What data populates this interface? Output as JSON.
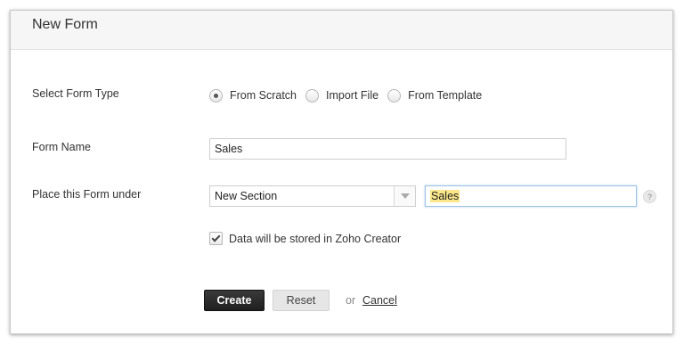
{
  "dialog": {
    "title": "New Form"
  },
  "form_type": {
    "label": "Select Form Type",
    "options": [
      {
        "label": "From Scratch",
        "selected": true
      },
      {
        "label": "Import File",
        "selected": false
      },
      {
        "label": "From Template",
        "selected": false
      }
    ]
  },
  "form_name": {
    "label": "Form Name",
    "value": "Sales"
  },
  "placement": {
    "label": "Place this Form under",
    "section_select_value": "New Section",
    "section_name_value": "Sales",
    "help_glyph": "?"
  },
  "storage": {
    "checked": true,
    "label": "Data will be stored in Zoho Creator"
  },
  "actions": {
    "create_label": "Create",
    "reset_label": "Reset",
    "or_text": "or",
    "cancel_label": "Cancel"
  },
  "colors": {
    "create_button_bg": "#2b2b2b",
    "highlight": "#fbe78a",
    "focus_border": "#9cc3e6"
  }
}
